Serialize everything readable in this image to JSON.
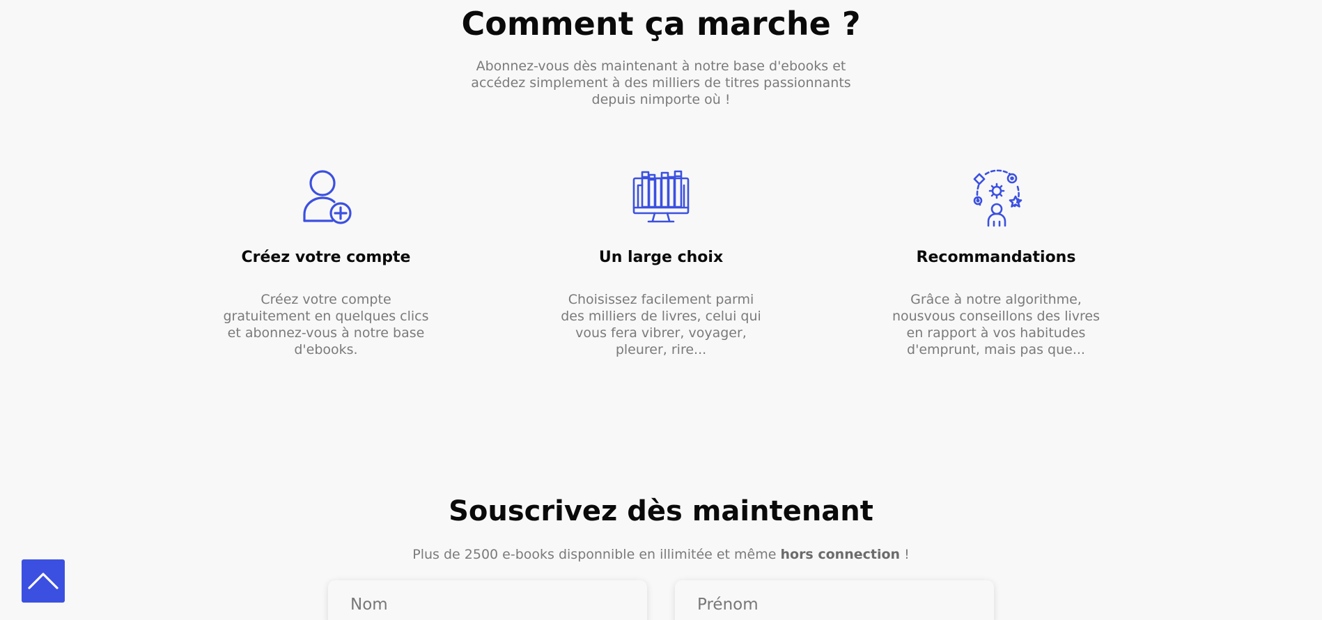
{
  "how_it_works": {
    "title": "Comment ça marche ?",
    "subtitle": "Abonnez-vous dès maintenant à notre base d'ebooks et accédez simplement à des milliers de titres passionnants depuis nimporte où !",
    "features": [
      {
        "icon": "user-add-icon",
        "title": "Créez votre compte",
        "text": "Créez votre compte gratuitement en quelques clics et abonnez-vous à notre base d'ebooks."
      },
      {
        "icon": "library-monitor-icon",
        "title": "Un large choix",
        "text": "Choisissez facilement parmi des milliers de livres, celui qui vous fera vibrer, voyager, pleurer, rire..."
      },
      {
        "icon": "recommendation-icon",
        "title": "Recommandations",
        "text": "Grâce à notre algorithme, nousvous conseillons des livres en rapport à vos habitudes d'emprunt, mais pas que..."
      }
    ]
  },
  "subscribe": {
    "title": "Souscrivez dès maintenant",
    "text_before": "Plus de 2500 e-books disponnible en illimitée et même ",
    "text_bold": "hors connection",
    "text_after": " !",
    "nom_placeholder": "Nom",
    "prenom_placeholder": "Prénom"
  },
  "back_to_top": {
    "icon": "chevron-up-icon"
  },
  "colors": {
    "accent": "#3b50e0",
    "background": "#f8f8f8",
    "heading": "#0a0a0a",
    "muted_text": "#7a7a7a"
  }
}
